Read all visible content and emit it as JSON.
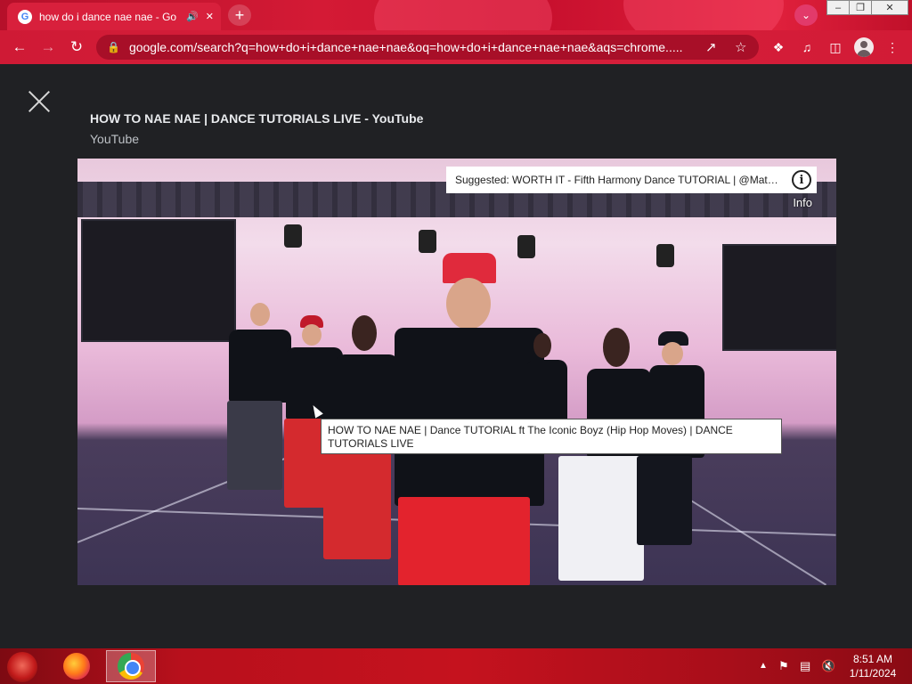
{
  "browser": {
    "tab": {
      "title": "how do i dance nae nae - Go",
      "favicon": "G",
      "speaker_icon": "speaker-icon",
      "close_icon": "close-icon"
    },
    "new_tab_icon": "+",
    "tab_search_icon": "chevron-down-icon",
    "window_controls": {
      "minimize": "‒",
      "maximize": "❐",
      "close": "✕"
    },
    "omnibox": {
      "url": "google.com/search?q=how+do+i+dance+nae+nae&oq=how+do+i+dance+nae+nae&aqs=chrome....."
    },
    "toolbar_icons": [
      "back-icon",
      "forward-icon",
      "reload-icon",
      "extensions-icon",
      "media-icon",
      "sidepanel-icon",
      "profile-icon",
      "menu-icon"
    ]
  },
  "viewer": {
    "title": "HOW TO NAE NAE | DANCE TUTORIALS LIVE - YouTube",
    "source": "YouTube",
    "suggested": "Suggested: WORTH IT - Fifth Harmony Dance TUTORIAL | @MattSt...",
    "info_label": "Info",
    "tooltip": "HOW TO NAE NAE | Dance TUTORIAL ft The Iconic Boyz (Hip Hop Moves) | DANCE TUTORIALS LIVE"
  },
  "taskbar": {
    "apps": [
      "firefox-icon",
      "chrome-icon"
    ],
    "active_app": "chrome-icon",
    "tray_icons": [
      "show-hidden-icon",
      "flag-icon",
      "network-icon",
      "volume-muted-icon"
    ],
    "time": "8:51 AM",
    "date": "1/11/2024"
  },
  "colors": {
    "chrome_accent": "#d8203c",
    "viewer_bg": "#202124",
    "taskbar": "#b8101c"
  }
}
